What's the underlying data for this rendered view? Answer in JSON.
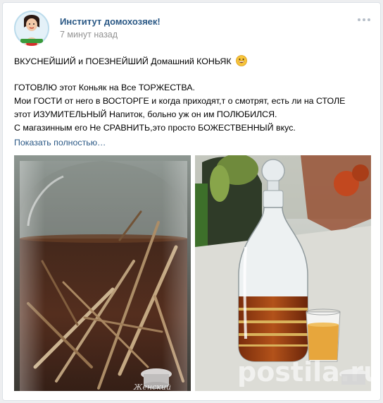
{
  "post": {
    "author": "Институт домохозяек!",
    "time": "7 минут назад",
    "headline": "ВКУСНЕЙШИЙ и ПОЕЗНЕЙШИЙ Домашний КОНЬЯК",
    "emoji_icon": "grinning-face-emoji",
    "lines": [
      "ГОТОВЛЮ этот Коньяк на Все ТОРЖЕСТВА.",
      "Мои ГОСТИ от него в ВОСТОРГЕ и когда приходят,т о смотрят, есть ли на СТОЛЕ",
      "этот ИЗУМИТЕЛЬНЫЙ Напиток, больно уж он им ПОЛЮБИЛСЯ.",
      "С магазинным его Не СРАВНИТЬ,это просто БОЖЕСТВЕННЫЙ вкус."
    ],
    "show_more": "Показать полностью…"
  },
  "photos": {
    "left_alt": "jar-with-cognac-and-oak-chips",
    "right_alt": "decanter-and-shot-glass-with-cognac"
  },
  "watermark": "postila.ru",
  "colors": {
    "link": "#2a5885",
    "muted": "#939393",
    "background": "#edeef0"
  }
}
